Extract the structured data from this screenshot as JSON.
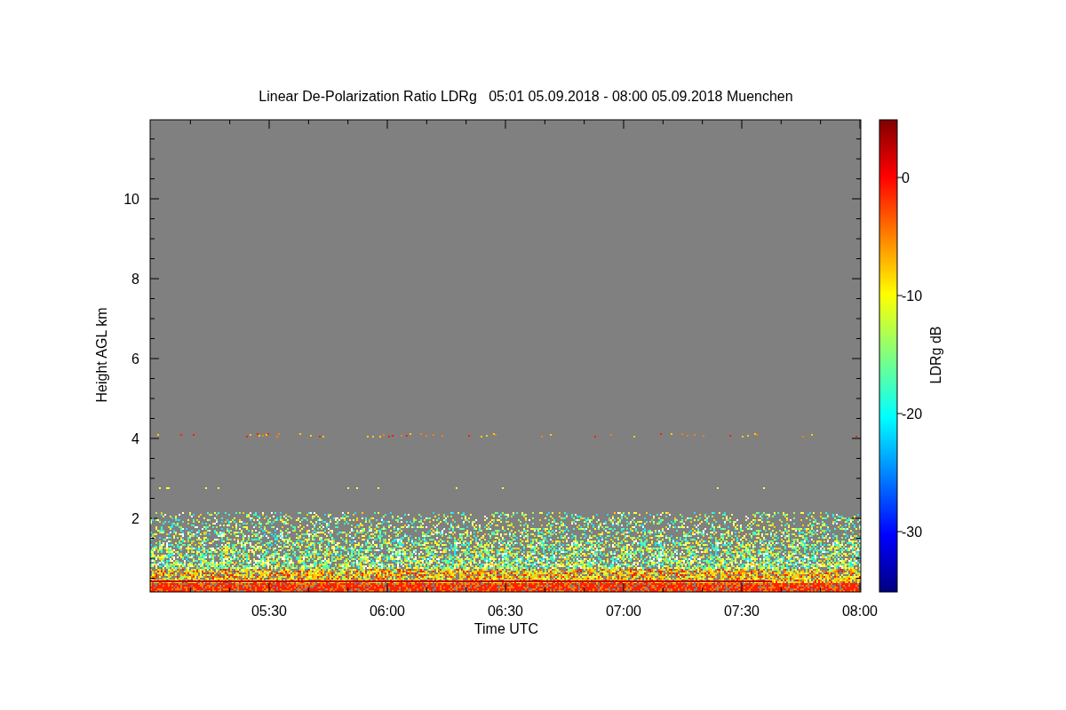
{
  "title": "Linear De-Polarization Ratio LDRg   05:01 05.09.2018 - 08:00 05.09.2018 Muenchen",
  "y_axis": {
    "label": "Height AGL km",
    "ticks": [
      "10",
      "8",
      "6",
      "4",
      "2"
    ]
  },
  "x_axis": {
    "label": "Time UTC",
    "ticks": [
      "05:30",
      "06:00",
      "06:30",
      "07:00",
      "07:30",
      "08:00"
    ]
  },
  "colorbar": {
    "label": "LDRg dB",
    "ticks": [
      "0",
      "-10",
      "-20",
      "-30"
    ]
  }
}
